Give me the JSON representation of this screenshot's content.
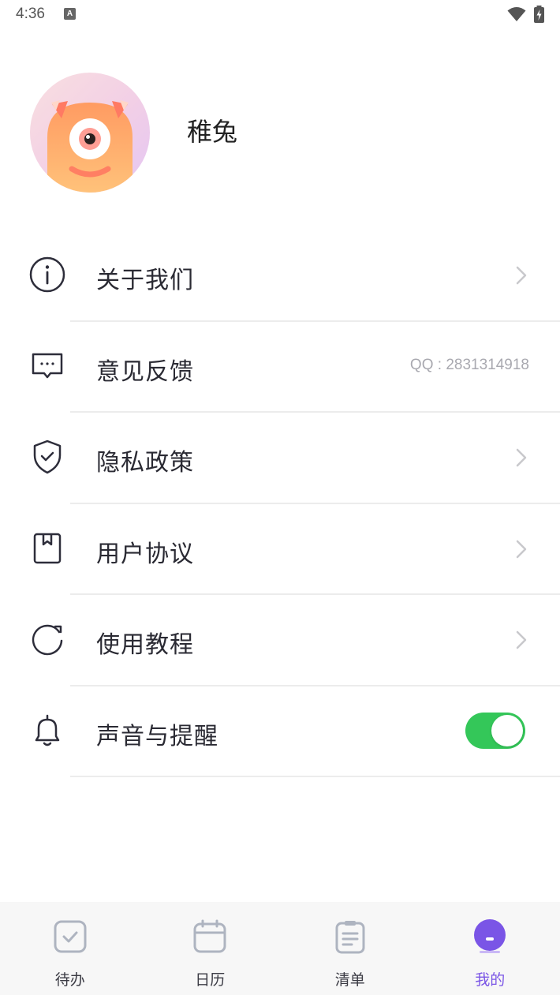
{
  "status_bar": {
    "time": "4:36",
    "notification_badge": "A"
  },
  "profile": {
    "username": "稚兔"
  },
  "menu": [
    {
      "label": "关于我们",
      "icon": "info-icon",
      "trailing": "chevron"
    },
    {
      "label": "意见反馈",
      "icon": "message-icon",
      "trailing": "text",
      "trailing_text": "QQ : 2831314918"
    },
    {
      "label": "隐私政策",
      "icon": "shield-check-icon",
      "trailing": "chevron"
    },
    {
      "label": "用户协议",
      "icon": "bookmark-icon",
      "trailing": "chevron"
    },
    {
      "label": "使用教程",
      "icon": "refresh-icon",
      "trailing": "chevron"
    },
    {
      "label": "声音与提醒",
      "icon": "bell-icon",
      "trailing": "toggle",
      "toggle_on": true
    }
  ],
  "bottom_nav": [
    {
      "label": "待办",
      "icon": "checkbox-icon",
      "active": false
    },
    {
      "label": "日历",
      "icon": "calendar-icon",
      "active": false
    },
    {
      "label": "清单",
      "icon": "clipboard-icon",
      "active": false
    },
    {
      "label": "我的",
      "icon": "profile-face-icon",
      "active": true
    }
  ],
  "colors": {
    "accent": "#7a55e6",
    "toggle_on": "#34c759",
    "divider": "#ececec",
    "text": "#2a2a33",
    "muted": "#a9a9b0"
  }
}
